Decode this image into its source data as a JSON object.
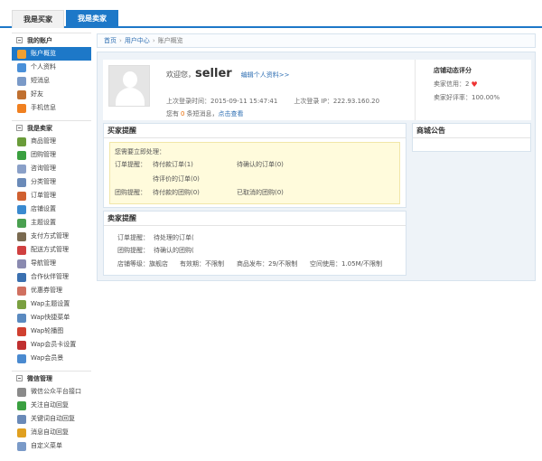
{
  "tabs": [
    "我是买家",
    "我是卖家"
  ],
  "sidebar": {
    "sections": [
      {
        "title": "我的账户",
        "items": [
          {
            "label": "账户概览",
            "active": true,
            "icon": "home-icon",
            "color": "#f0a030"
          },
          {
            "label": "个人资料",
            "active": false,
            "icon": "profile-icon",
            "color": "#4a90d9"
          },
          {
            "label": "短消息",
            "active": false,
            "icon": "message-icon",
            "color": "#7a9ac8"
          },
          {
            "label": "好友",
            "active": false,
            "icon": "friends-icon",
            "color": "#c07030"
          },
          {
            "label": "手机信息",
            "active": false,
            "icon": "mobile-icon",
            "color": "#f08020"
          }
        ]
      },
      {
        "title": "我是卖家",
        "items": [
          {
            "label": "商品管理",
            "active": false,
            "icon": "goods-icon",
            "color": "#6a9c3a"
          },
          {
            "label": "团购管理",
            "active": false,
            "icon": "groupbuy-icon",
            "color": "#3aa040"
          },
          {
            "label": "咨询管理",
            "active": false,
            "icon": "consult-icon",
            "color": "#8aa0c8"
          },
          {
            "label": "分类管理",
            "active": false,
            "icon": "category-icon",
            "color": "#6a8ab8"
          },
          {
            "label": "订单管理",
            "active": false,
            "icon": "order-icon",
            "color": "#d06030"
          },
          {
            "label": "店铺设置",
            "active": false,
            "icon": "store-icon",
            "color": "#3a8ad0"
          },
          {
            "label": "主题设置",
            "active": false,
            "icon": "theme-icon",
            "color": "#4aa050"
          },
          {
            "label": "支付方式管理",
            "active": false,
            "icon": "payment-icon",
            "color": "#7a6a50"
          },
          {
            "label": "配送方式管理",
            "active": false,
            "icon": "delivery-icon",
            "color": "#d04040"
          },
          {
            "label": "导航管理",
            "active": false,
            "icon": "nav-icon",
            "color": "#8a8ab0"
          },
          {
            "label": "合作伙伴管理",
            "active": false,
            "icon": "partner-icon",
            "color": "#3a70b0"
          },
          {
            "label": "优惠券管理",
            "active": false,
            "icon": "coupon-icon",
            "color": "#d07060"
          },
          {
            "label": "Wap主题设置",
            "active": false,
            "icon": "wap-theme-icon",
            "color": "#7aa040"
          },
          {
            "label": "Wap快捷菜单",
            "active": false,
            "icon": "wap-menu-icon",
            "color": "#5a8ac0"
          },
          {
            "label": "Wap轮播图",
            "active": false,
            "icon": "wap-slider-icon",
            "color": "#d04030"
          },
          {
            "label": "Wap会员卡设置",
            "active": false,
            "icon": "wap-card-icon",
            "color": "#c03030"
          },
          {
            "label": "Wap会员景",
            "active": false,
            "icon": "wap-member-icon",
            "color": "#4a8ad0"
          }
        ]
      },
      {
        "title": "微信管理",
        "items": [
          {
            "label": "微信公众平台接口",
            "active": false,
            "icon": "wechat-api-icon",
            "color": "#8a8a8a"
          },
          {
            "label": "关注自动回复",
            "active": false,
            "icon": "follow-reply-icon",
            "color": "#3aa040"
          },
          {
            "label": "关键词自动回复",
            "active": false,
            "icon": "keyword-reply-icon",
            "color": "#6a8ab8"
          },
          {
            "label": "消息自动回复",
            "active": false,
            "icon": "msg-reply-icon",
            "color": "#e0a020"
          },
          {
            "label": "自定义菜单",
            "active": false,
            "icon": "custom-menu-icon",
            "color": "#7a9ac8"
          }
        ]
      }
    ]
  },
  "breadcrumb": [
    "首页",
    "用户中心",
    "账户概览"
  ],
  "profile": {
    "welcome": "欢迎您，",
    "username": "seller",
    "edit_link": "编辑个人资料>>",
    "last_login_time": "上次登录时间：2015-09-11 15:47:41",
    "last_login_ip": "上次登录 IP：222.93.160.20",
    "msg_prefix": "您有",
    "msg_count": "0",
    "msg_suffix": "条短消息，",
    "msg_link": "点击查看"
  },
  "rating": {
    "title": "店铺动态评分",
    "credit": "卖家信用：2",
    "positive": "卖家好评率：100.00%"
  },
  "buyer_reminder": {
    "title": "买家提醒",
    "prompt": "您需要立即处理：",
    "order_label": "订单提醒：",
    "order_links": [
      "待付款订单(1)",
      "待确认的订单(0)",
      "待评价的订单(0)"
    ],
    "group_label": "团购提醒：",
    "group_links": [
      "待付款的团购(0)",
      "已取消的团购(0)"
    ]
  },
  "seller_reminder": {
    "title": "卖家提醒",
    "order_label": "订单提醒：",
    "order_link": "待处理的订单(",
    "group_label": "团购提醒：",
    "group_link": "待确认的团购(",
    "store_level": "店铺等级：旗舰店",
    "valid": "有效期：不限制",
    "goods": "商品发布：29/不限制",
    "space": "空间使用：1.05M/不限制"
  },
  "notice": {
    "title": "商城公告"
  }
}
